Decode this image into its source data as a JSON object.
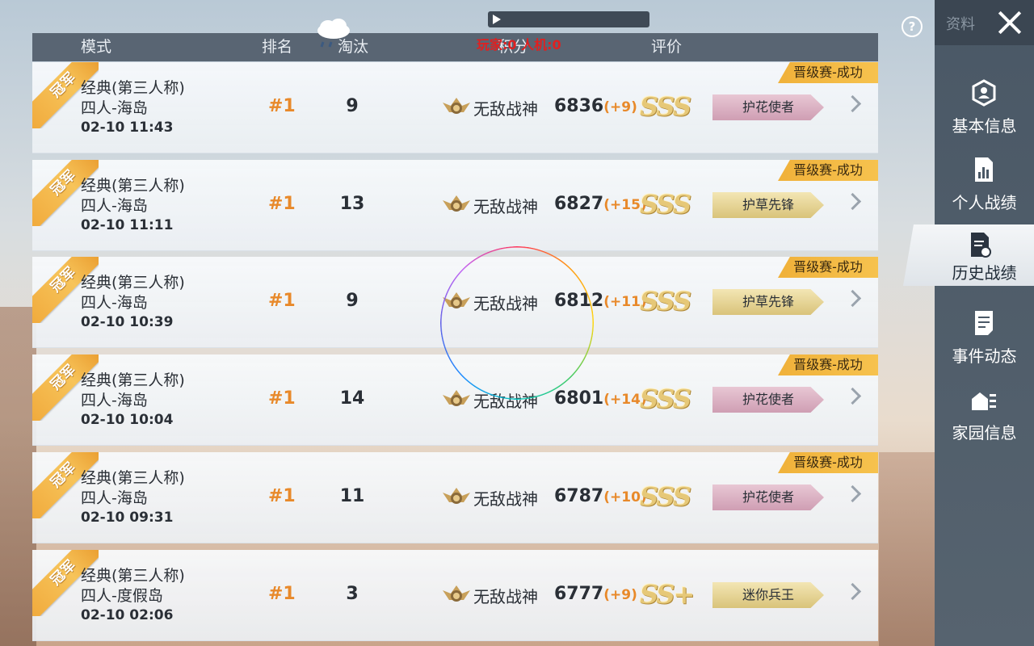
{
  "overlay": {
    "player_count": "玩家:0 人机:0"
  },
  "header": {
    "mode": "模式",
    "rank": "排名",
    "kills": "淘汰",
    "score": "积分",
    "rating": "评价"
  },
  "rows": [
    {
      "badge": "冠军",
      "mode": "经典(第三人称)",
      "map": "四人-海岛",
      "time": "02-10 11:43",
      "rank": "#1",
      "kills": "9",
      "tier": "无敌战神",
      "score": "6836",
      "delta": "(+9)",
      "grade": "SSS",
      "title": "护花使者",
      "title_color": "pink",
      "status": "晋级赛-成功"
    },
    {
      "badge": "冠军",
      "mode": "经典(第三人称)",
      "map": "四人-海岛",
      "time": "02-10 11:11",
      "rank": "#1",
      "kills": "13",
      "tier": "无敌战神",
      "score": "6827",
      "delta": "(+15)",
      "grade": "SSS",
      "title": "护草先锋",
      "title_color": "gold",
      "status": "晋级赛-成功"
    },
    {
      "badge": "冠军",
      "mode": "经典(第三人称)",
      "map": "四人-海岛",
      "time": "02-10 10:39",
      "rank": "#1",
      "kills": "9",
      "tier": "无敌战神",
      "score": "6812",
      "delta": "(+11)",
      "grade": "SSS",
      "title": "护草先锋",
      "title_color": "gold",
      "status": "晋级赛-成功"
    },
    {
      "badge": "冠军",
      "mode": "经典(第三人称)",
      "map": "四人-海岛",
      "time": "02-10 10:04",
      "rank": "#1",
      "kills": "14",
      "tier": "无敌战神",
      "score": "6801",
      "delta": "(+14)",
      "grade": "SSS",
      "title": "护花使者",
      "title_color": "pink",
      "status": "晋级赛-成功"
    },
    {
      "badge": "冠军",
      "mode": "经典(第三人称)",
      "map": "四人-海岛",
      "time": "02-10 09:31",
      "rank": "#1",
      "kills": "11",
      "tier": "无敌战神",
      "score": "6787",
      "delta": "(+10)",
      "grade": "SSS",
      "title": "护花使者",
      "title_color": "pink",
      "status": "晋级赛-成功"
    },
    {
      "badge": "冠军",
      "mode": "经典(第三人称)",
      "map": "四人-度假岛",
      "time": "02-10 02:06",
      "rank": "#1",
      "kills": "3",
      "tier": "无敌战神",
      "score": "6777",
      "delta": "(+9)",
      "grade": "SS+",
      "title": "迷你兵王",
      "title_color": "gold",
      "status": ""
    }
  ],
  "sidebar": {
    "top_label": "资料",
    "items": [
      {
        "label": "基本信息",
        "icon": "profile-icon"
      },
      {
        "label": "个人战绩",
        "icon": "stats-icon"
      },
      {
        "label": "历史战绩",
        "icon": "history-icon"
      },
      {
        "label": "事件动态",
        "icon": "events-icon"
      },
      {
        "label": "家园信息",
        "icon": "home-icon"
      }
    ],
    "active_index": 2
  },
  "colors": {
    "accent": "#e8892a",
    "ribbon": "#f0a83a",
    "sidebar": "#4a5866"
  }
}
